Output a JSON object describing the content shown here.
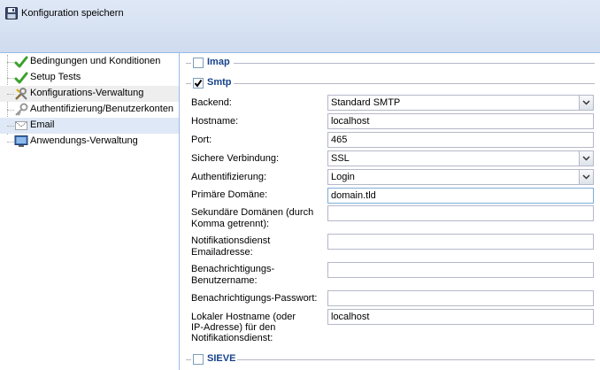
{
  "toolbar": {
    "save_label": "Konfiguration speichern",
    "save_icon": "floppy-disk-icon"
  },
  "tree": {
    "items": [
      {
        "label": "Bedingungen und Konditionen",
        "icon": "green-check-icon"
      },
      {
        "label": "Setup Tests",
        "icon": "green-check-icon"
      },
      {
        "label": "Konfigurations-Verwaltung",
        "icon": "tools-icon"
      },
      {
        "label": "Authentifizierung/Benutzerkonten",
        "icon": "key-icon"
      },
      {
        "label": "Email",
        "icon": "email-icon"
      },
      {
        "label": "Anwendungs-Verwaltung",
        "icon": "monitor-icon"
      }
    ]
  },
  "sections": {
    "imap": {
      "title": "Imap",
      "checked": false
    },
    "smtp": {
      "title": "Smtp",
      "checked": true
    },
    "sieve": {
      "title": "SIEVE",
      "checked": false
    }
  },
  "form": {
    "backend": {
      "label": "Backend:",
      "value": "Standard  SMTP"
    },
    "hostname": {
      "label": "Hostname:",
      "value": "localhost"
    },
    "port": {
      "label": "Port:",
      "value": "465"
    },
    "secure": {
      "label": "Sichere Verbindung:",
      "value": "SSL"
    },
    "auth": {
      "label": "Authentifizierung:",
      "value": "Login"
    },
    "primary_domain": {
      "label": "Primäre Domäne:",
      "value": "domain.tld"
    },
    "secondary_domains": {
      "label_line1": "Sekundäre Domänen (durch",
      "label_line2": "Komma getrennt):",
      "value": ""
    },
    "notify_email": {
      "label_line1": "Notifikationsdienst",
      "label_line2": "Emailadresse:",
      "value": ""
    },
    "notify_user": {
      "label_line1": "Benachrichtigungs-",
      "label_line2": "Benutzername:",
      "value": ""
    },
    "notify_pass": {
      "label": "Benachrichtigungs-Passwort:",
      "value": ""
    },
    "local_hostname": {
      "label_line1": "Lokaler Hostname (oder",
      "label_line2": "IP-Adresse) für den",
      "label_line3": "Notifikationsdienst:",
      "value": "localhost"
    }
  },
  "colors": {
    "toolbar_bg": "#dfe8f6",
    "selected_bg": "#dfe8f6",
    "fieldset_title": "#15428b",
    "check_green": "#3aa02c"
  }
}
